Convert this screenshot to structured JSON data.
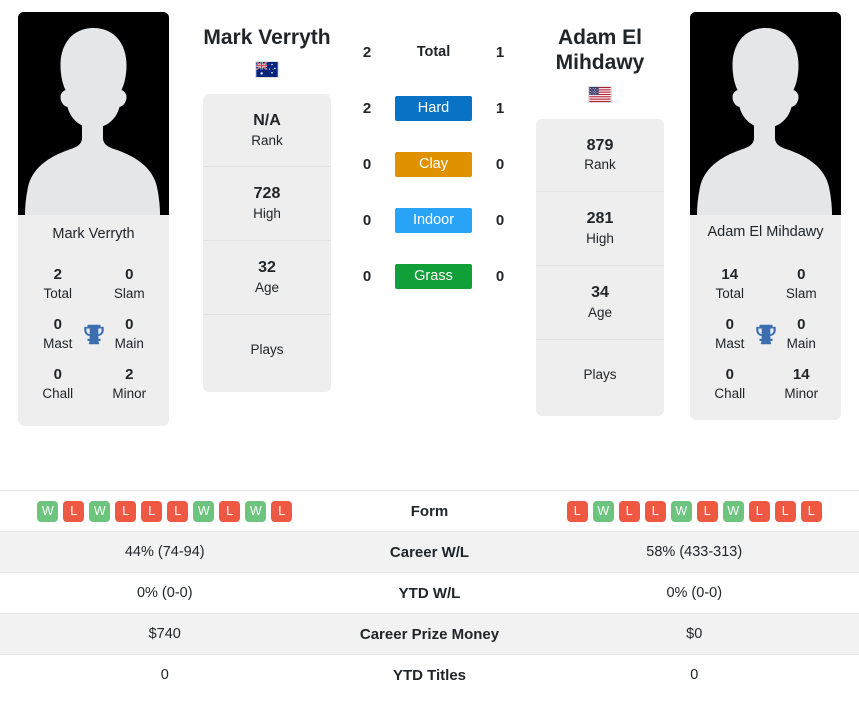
{
  "colors": {
    "hard": "#0a72c4",
    "clay": "#e09100",
    "indoor": "#29a3f5",
    "grass": "#119f38",
    "win": "#6cc47e",
    "loss": "#ef5843",
    "trophy": "#3b6fb0",
    "card_bg": "#eeeeee",
    "row_shade": "#f2f2f2"
  },
  "player_left": {
    "name": "Mark Verryth",
    "flag": "australia-flag",
    "photo_caption": "Mark Verryth",
    "honours": [
      {
        "value": "2",
        "label": "Total",
        "value2": "0",
        "label2": "Slam"
      },
      {
        "value": "0",
        "label": "Mast",
        "value2": "0",
        "label2": "Main"
      },
      {
        "value": "0",
        "label": "Chall",
        "value2": "2",
        "label2": "Minor"
      }
    ],
    "stack": [
      {
        "value": "N/A",
        "label": "Rank"
      },
      {
        "value": "728",
        "label": "High"
      },
      {
        "value": "32",
        "label": "Age"
      },
      {
        "value": "",
        "label": "Plays"
      }
    ]
  },
  "player_right": {
    "name": "Adam El Mihdawy",
    "flag": "usa-flag",
    "photo_caption": "Adam El Mihdawy",
    "honours": [
      {
        "value": "14",
        "label": "Total",
        "value2": "0",
        "label2": "Slam"
      },
      {
        "value": "0",
        "label": "Mast",
        "value2": "0",
        "label2": "Main"
      },
      {
        "value": "0",
        "label": "Chall",
        "value2": "14",
        "label2": "Minor"
      }
    ],
    "stack": [
      {
        "value": "879",
        "label": "Rank"
      },
      {
        "value": "281",
        "label": "High"
      },
      {
        "value": "34",
        "label": "Age"
      },
      {
        "value": "",
        "label": "Plays"
      }
    ]
  },
  "surfaces": [
    {
      "label": "Total",
      "left": "2",
      "right": "1",
      "style": "plain"
    },
    {
      "label": "Hard",
      "left": "2",
      "right": "1",
      "style": "hard"
    },
    {
      "label": "Clay",
      "left": "0",
      "right": "0",
      "style": "clay"
    },
    {
      "label": "Indoor",
      "left": "0",
      "right": "0",
      "style": "indoor"
    },
    {
      "label": "Grass",
      "left": "0",
      "right": "0",
      "style": "grass"
    }
  ],
  "table": {
    "form_label": "Form",
    "form_left": [
      "W",
      "L",
      "W",
      "L",
      "L",
      "L",
      "W",
      "L",
      "W",
      "L"
    ],
    "form_right": [
      "L",
      "W",
      "L",
      "L",
      "W",
      "L",
      "W",
      "L",
      "L",
      "L"
    ],
    "rows": [
      {
        "label": "Career W/L",
        "left": "44% (74-94)",
        "right": "58% (433-313)"
      },
      {
        "label": "YTD W/L",
        "left": "0% (0-0)",
        "right": "0% (0-0)"
      },
      {
        "label": "Career Prize Money",
        "left": "$740",
        "right": "$0"
      },
      {
        "label": "YTD Titles",
        "left": "0",
        "right": "0"
      }
    ]
  }
}
